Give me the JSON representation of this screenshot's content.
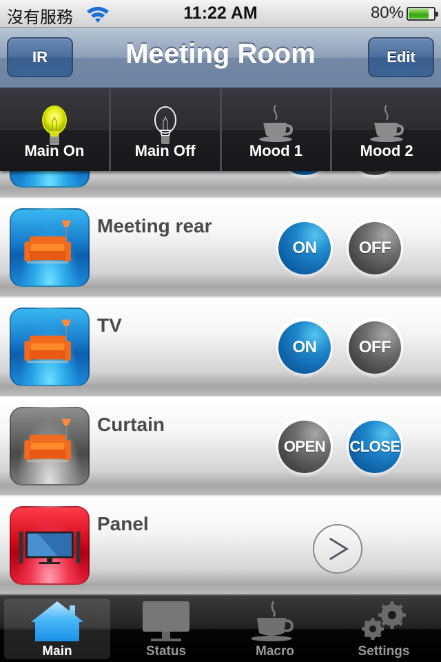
{
  "status_bar": {
    "carrier": "沒有服務",
    "wifi_icon": "wifi-icon",
    "time": "11:22 AM",
    "battery_percent_label": "80%",
    "battery_level": 0.8
  },
  "nav": {
    "left_button": "IR",
    "title": "Meeting Room",
    "right_button": "Edit"
  },
  "scenes": [
    {
      "label": "Main On",
      "icon": "lightbulb-on-icon"
    },
    {
      "label": "Main Off",
      "icon": "lightbulb-off-icon"
    },
    {
      "label": "Mood 1",
      "icon": "coffee-cup-icon"
    },
    {
      "label": "Mood 2",
      "icon": "coffee-cup-icon"
    }
  ],
  "rows": [
    {
      "title": "",
      "icon": "sofa-icon",
      "icon_color": "blue",
      "buttons": [
        "ON",
        "OFF"
      ],
      "partial": true
    },
    {
      "title": "Meeting rear",
      "icon": "sofa-icon",
      "icon_color": "blue",
      "buttons": [
        "ON",
        "OFF"
      ]
    },
    {
      "title": "TV",
      "icon": "sofa-icon",
      "icon_color": "blue",
      "buttons": [
        "ON",
        "OFF"
      ]
    },
    {
      "title": "Curtain",
      "icon": "sofa-icon",
      "icon_color": "gray",
      "buttons": [
        "OPEN",
        "CLOSE"
      ]
    },
    {
      "title": "Panel",
      "icon": "tv-icon",
      "icon_color": "red",
      "action": "chevron-right-icon"
    }
  ],
  "tabs": [
    {
      "label": "Main",
      "icon": "home-icon",
      "active": true
    },
    {
      "label": "Status",
      "icon": "monitor-icon",
      "active": false
    },
    {
      "label": "Macro",
      "icon": "coffee-cup-icon",
      "active": false
    },
    {
      "label": "Settings",
      "icon": "gears-icon",
      "active": false
    }
  ],
  "colors": {
    "nav_bar": "#7d92ae",
    "button_blue": "#1676c4",
    "button_gray": "#555555",
    "battery_green": "#3aa316"
  }
}
